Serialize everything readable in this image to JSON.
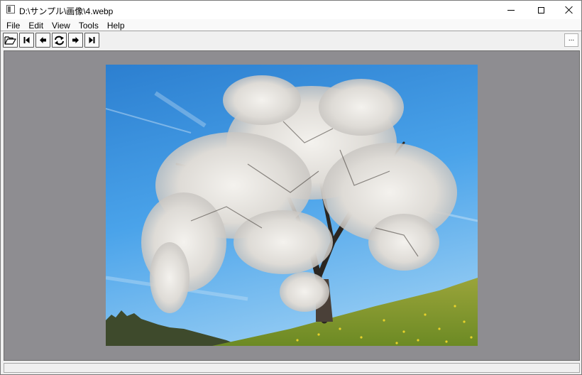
{
  "window": {
    "title": "D:\\サンプル\\画像\\4.webp"
  },
  "menu": {
    "items": [
      {
        "label": "File"
      },
      {
        "label": "Edit"
      },
      {
        "label": "View"
      },
      {
        "label": "Tools"
      },
      {
        "label": "Help"
      }
    ]
  },
  "toolbar": {
    "buttons": [
      "open-folder-icon",
      "first-image-icon",
      "previous-image-icon",
      "reload-icon",
      "next-image-icon",
      "last-image-icon"
    ],
    "more_label": "..."
  },
  "viewer": {
    "background": "#8e8d91"
  },
  "status": {
    "text": ""
  }
}
